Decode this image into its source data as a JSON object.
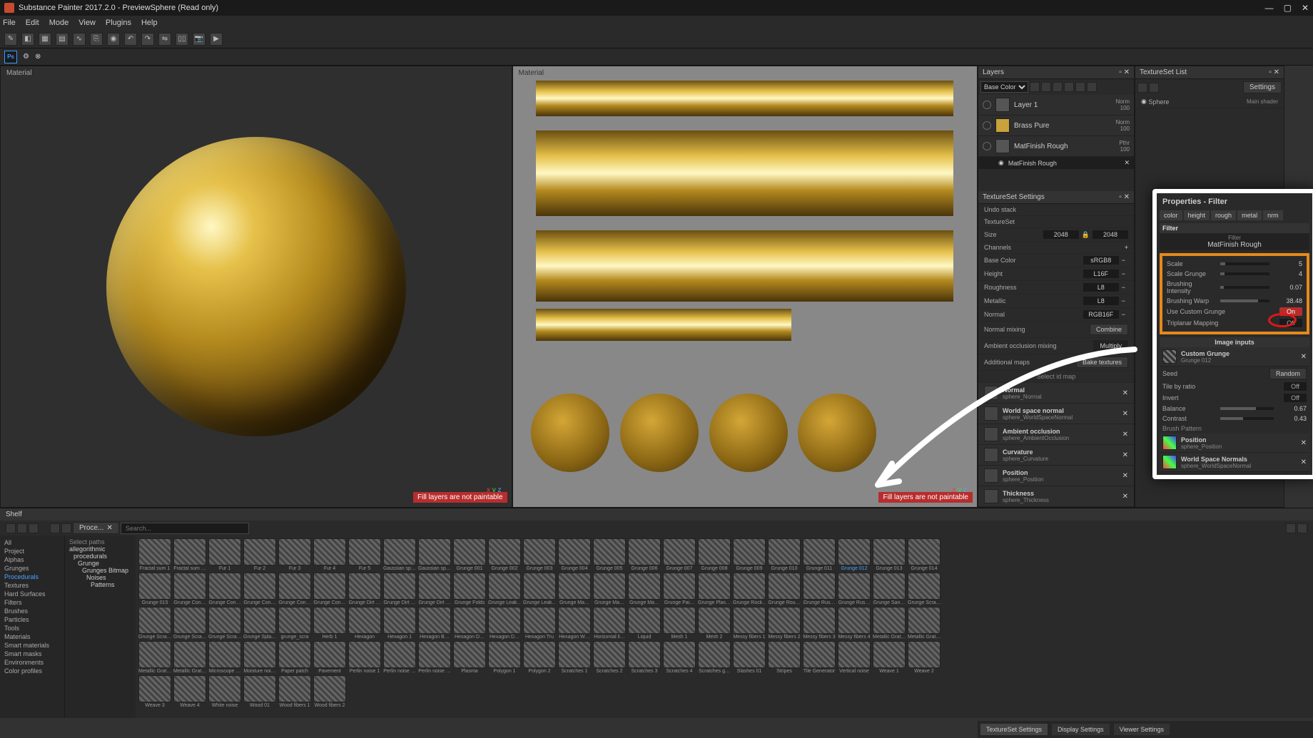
{
  "titlebar": {
    "app": "Substance Painter 2017.2.0",
    "doc": "PreviewSphere (Read only)"
  },
  "menus": [
    "File",
    "Edit",
    "Mode",
    "View",
    "Plugins",
    "Help"
  ],
  "viewport": {
    "label": "Material",
    "warning": "Fill layers are not paintable",
    "axes": [
      "x",
      "y",
      "z"
    ]
  },
  "layers": {
    "title": "Layers",
    "channel": "Base Color",
    "items": [
      {
        "name": "Layer 1",
        "blend": "Norm",
        "opacity": "100"
      },
      {
        "name": "Brass Pure",
        "blend": "Norm",
        "opacity": "100"
      },
      {
        "name": "MatFinish Rough",
        "blend": "Pthr",
        "opacity": "100"
      }
    ],
    "effect": "MatFinish Rough"
  },
  "tslist": {
    "title": "TextureSet List",
    "settings": "Settings",
    "item": "Sphere",
    "shader": "Main shader"
  },
  "tss": {
    "title": "TextureSet Settings",
    "undo": "Undo stack",
    "texset": "TextureSet",
    "sizeLabel": "Size",
    "size": "2048",
    "channels": "Channels",
    "rows": [
      {
        "name": "Base Color",
        "fmt": "sRGB8"
      },
      {
        "name": "Height",
        "fmt": "L16F"
      },
      {
        "name": "Roughness",
        "fmt": "L8"
      },
      {
        "name": "Metallic",
        "fmt": "L8"
      },
      {
        "name": "Normal",
        "fmt": "RGB16F"
      }
    ],
    "normalMixingLabel": "Normal mixing",
    "normalMixing": "Combine",
    "aoMixLabel": "Ambient occlusion mixing",
    "aoMix": "Multiply",
    "addMaps": "Additional maps",
    "bake": "Bake textures",
    "selid": "Select id map",
    "maps": [
      {
        "name": "Normal",
        "src": "sphere_Normal"
      },
      {
        "name": "World space normal",
        "src": "sphere_WorldSpaceNormal"
      },
      {
        "name": "Ambient occlusion",
        "src": "sphere_AmbientOcclusion"
      },
      {
        "name": "Curvature",
        "src": "sphere_Curvature"
      },
      {
        "name": "Position",
        "src": "sphere_Position"
      },
      {
        "name": "Thickness",
        "src": "sphere_Thickness"
      }
    ]
  },
  "shelf": {
    "title": "Shelf",
    "search": "Search...",
    "breadcrumb": "Proce...",
    "cats": [
      "All",
      "Project",
      "Alphas",
      "Grunges",
      "Procedurals",
      "Textures",
      "Hard Surfaces",
      "Filters",
      "Brushes",
      "Particles",
      "Tools",
      "Materials",
      "Smart materials",
      "Smart masks",
      "Environments",
      "Color profiles"
    ],
    "catSel": 4,
    "tree": [
      "Select paths",
      "allegorithmic",
      "procedurals",
      "Grunge",
      "Grunges Bitmap",
      "Noises",
      "Patterns"
    ],
    "items": [
      "Fractal sum 1",
      "Fractal sum …",
      "Fur 1",
      "Fur 2",
      "Fur 3",
      "Fur 4",
      "Fur 5",
      "Gaussian sp…",
      "Gaussian sp…",
      "Grunge 001",
      "Grunge 002",
      "Grunge 003",
      "Grunge 004",
      "Grunge 005",
      "Grunge 006",
      "Grunge 007",
      "Grunge 008",
      "Grunge 009",
      "Grunge 010",
      "Grunge 011",
      "Grunge 012",
      "Grunge 013",
      "Grunge 014",
      "Grunge 015",
      "Grunge Con…",
      "Grunge Con…",
      "Grunge Con…",
      "Grunge Con…",
      "Grunge Con…",
      "Grunge Dirt …",
      "Grunge Dirt …",
      "Grunge Dirt …",
      "Grunge Folds",
      "Grunge Leak…",
      "Grunge Leak…",
      "Grunge Ma…",
      "Grunge Ma…",
      "Grunge Ma…",
      "Grunge Pai…",
      "Grunge Plas…",
      "Grunge Rock…",
      "Grunge Rou…",
      "Grunge Rus…",
      "Grunge Rus…",
      "Grunge San…",
      "Grunge Scra…",
      "Grunge Scra…",
      "Grunge Scra…",
      "Grunge Scra…",
      "Grunge Spla…",
      "grunge_scra",
      "Herb 1",
      "Hexagon",
      "Hexagon 1",
      "Hexagon B…",
      "Hexagon D…",
      "Hexagon D…",
      "Hexagon Tru",
      "Hexagon W…",
      "Horizontal li…",
      "Liquid",
      "Mesh 1",
      "Mesh 2",
      "Messy fibers 1",
      "Messy fibers 2",
      "Messy fibers 3",
      "Messy fibers 4",
      "Metallic Grat…",
      "Metallic Grat…",
      "Metallic Grat…",
      "Metallic Grat…",
      "Microscope …",
      "Moisture noi…",
      "Paper patch",
      "Pavement",
      "Perlin noise 1",
      "Perlin noise …",
      "Perlin noise …",
      "Plasma",
      "Polygon 1",
      "Polygon 2",
      "Scratches 1",
      "Scratches 2",
      "Scratches 3",
      "Scratches 4",
      "Scratches g…",
      "Slashes 01",
      "Stripes",
      "Tile Generator",
      "Vertical noise",
      "Weave 1",
      "Weave 2",
      "Weave 3",
      "Weave 4",
      "White noise",
      "Wood 01",
      "Wood fibers 1",
      "Wood fibers 2"
    ],
    "itemSel": 20
  },
  "properties": {
    "title": "Properties - Filter",
    "tabs": [
      "color",
      "height",
      "rough",
      "metal",
      "nrm"
    ],
    "filterHdr": "Filter",
    "filterLabel": "Filter",
    "filterName": "MatFinish Rough",
    "params": {
      "scale": {
        "label": "Scale",
        "value": "5"
      },
      "scaleGrunge": {
        "label": "Scale Grunge",
        "value": "4"
      },
      "brushIntensity": {
        "label": "Brushing Intensity",
        "value": "0.07"
      },
      "brushWarp": {
        "label": "Brushing Warp",
        "value": "38.48"
      },
      "useCustom": {
        "label": "Use Custom Grunge",
        "value": "On"
      },
      "triplanar": {
        "label": "Triplanar Mapping",
        "value": "Off"
      }
    },
    "imgInputsHdr": "Image inputs",
    "customGrunge": {
      "name": "Custom Grunge",
      "src": "Grunge 012"
    },
    "seed": {
      "label": "Seed",
      "btn": "Random"
    },
    "tile": {
      "label": "Tile by ratio",
      "value": "Off"
    },
    "invert": {
      "label": "Invert",
      "value": "Off"
    },
    "balance": {
      "label": "Balance",
      "value": "0.67"
    },
    "contrast": {
      "label": "Contrast",
      "value": "0.43"
    },
    "brushPattern": "Brush Pattern",
    "imgs": [
      {
        "name": "Position",
        "src": "sphere_Position"
      },
      {
        "name": "World Space Normals",
        "src": "sphere_WorldSpaceNormal"
      }
    ]
  },
  "bottomTabs": [
    "TextureSet Settings",
    "Display Settings",
    "Viewer Settings"
  ]
}
